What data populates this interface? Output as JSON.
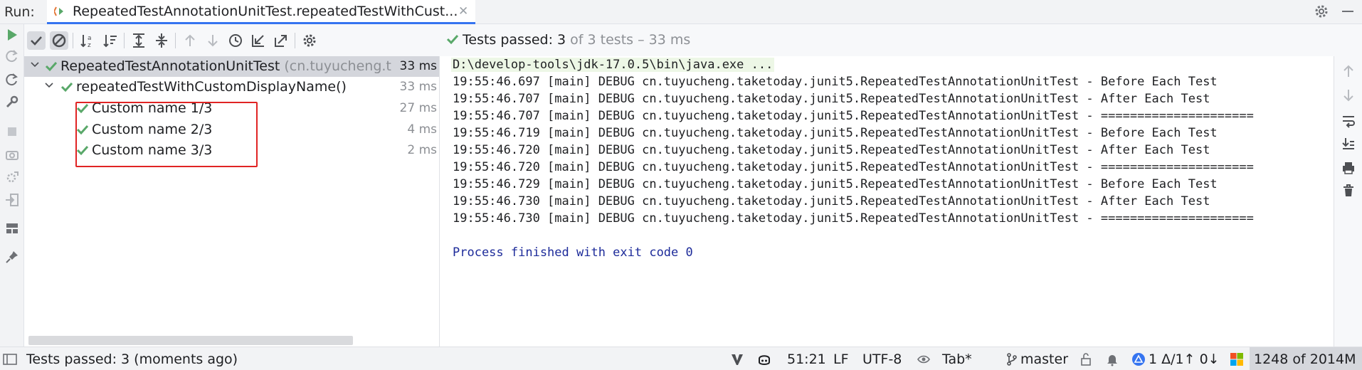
{
  "topbar": {
    "run_label": "Run:",
    "tab_title": "RepeatedTestAnnotationUnitTest.repeatedTestWithCust...",
    "close_glyph": "✕"
  },
  "summary": {
    "prefix": "Tests passed: ",
    "passed": "3",
    "suffix": " of 3 tests – 33 ms"
  },
  "tree": {
    "rows": [
      {
        "label": "RepeatedTestAnnotationUnitTest",
        "pkg": " (cn.tuyucheng.t",
        "time": "33 ms"
      },
      {
        "label": "repeatedTestWithCustomDisplayName()",
        "time": "33 ms"
      },
      {
        "label": "Custom name 1/3",
        "time": "27 ms"
      },
      {
        "label": "Custom name 2/3",
        "time": "4 ms"
      },
      {
        "label": "Custom name 3/3",
        "time": "2 ms"
      }
    ]
  },
  "console": {
    "command": "D:\\develop-tools\\jdk-17.0.5\\bin\\java.exe ...",
    "lines": [
      "19:55:46.697 [main] DEBUG cn.tuyucheng.taketoday.junit5.RepeatedTestAnnotationUnitTest - Before Each Test",
      "19:55:46.707 [main] DEBUG cn.tuyucheng.taketoday.junit5.RepeatedTestAnnotationUnitTest - After Each Test",
      "19:55:46.707 [main] DEBUG cn.tuyucheng.taketoday.junit5.RepeatedTestAnnotationUnitTest - =====================",
      "19:55:46.719 [main] DEBUG cn.tuyucheng.taketoday.junit5.RepeatedTestAnnotationUnitTest - Before Each Test",
      "19:55:46.720 [main] DEBUG cn.tuyucheng.taketoday.junit5.RepeatedTestAnnotationUnitTest - After Each Test",
      "19:55:46.720 [main] DEBUG cn.tuyucheng.taketoday.junit5.RepeatedTestAnnotationUnitTest - =====================",
      "19:55:46.729 [main] DEBUG cn.tuyucheng.taketoday.junit5.RepeatedTestAnnotationUnitTest - Before Each Test",
      "19:55:46.730 [main] DEBUG cn.tuyucheng.taketoday.junit5.RepeatedTestAnnotationUnitTest - After Each Test",
      "19:55:46.730 [main] DEBUG cn.tuyucheng.taketoday.junit5.RepeatedTestAnnotationUnitTest - ====================="
    ],
    "finished": "Process finished with exit code 0"
  },
  "statusbar": {
    "message": "Tests passed: 3 (moments ago)",
    "position": "51:21",
    "line_sep": "LF",
    "encoding": "UTF-8",
    "indent": "Tab*",
    "branch": "master",
    "vcs_changes": "1 Δ/1↑ 0↓",
    "memory": "1248 of 2014M"
  },
  "colors": {
    "pass_green": "#59a869",
    "accent_blue": "#3574f0",
    "highlight_red": "#e02424"
  },
  "icons": {
    "left_toolbar": [
      "run-icon",
      "rerun-failed-icon",
      "rerun-icon",
      "wrench-icon",
      "stop-icon",
      "camera-icon",
      "gear-export-icon",
      "login-icon",
      "layout-icon",
      "pin-icon"
    ],
    "tree_toolbar": [
      "show-passed-icon",
      "show-ignored-icon",
      "sort-alpha-icon",
      "sort-duration-icon",
      "expand-all-icon",
      "collapse-all-icon",
      "prev-failed-icon",
      "next-failed-icon",
      "history-icon",
      "import-tests-icon",
      "export-tests-icon",
      "settings-icon"
    ],
    "right_toolbar": [
      "up-icon",
      "down-icon",
      "soft-wrap-icon",
      "scroll-to-end-icon",
      "print-icon",
      "trash-icon"
    ]
  }
}
